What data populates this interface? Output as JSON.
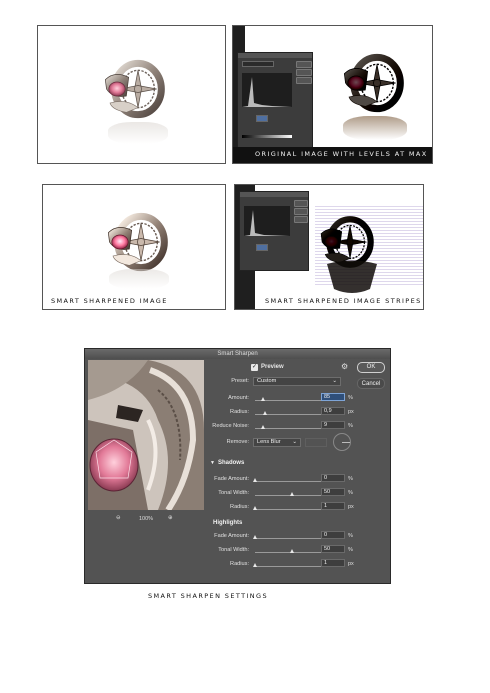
{
  "captions": {
    "original": "ORIGINAL IMAGE WITH LEVELS AT MAX",
    "smart_sharpened": "SMART SHARPENED IMAGE",
    "stripes": "SMART SHARPENED IMAGE STRIPES",
    "settings": "SMART SHARPEN SETTINGS"
  },
  "dialog": {
    "title": "Smart Sharpen",
    "preview_label": "Preview",
    "preview_checked": true,
    "ok_label": "OK",
    "cancel_label": "Cancel",
    "zoom": "100%",
    "preset_label": "Preset:",
    "preset_value": "Custom",
    "amount": {
      "label": "Amount:",
      "value": "85",
      "unit": "%"
    },
    "radius": {
      "label": "Radius:",
      "value": "0,9",
      "unit": "px"
    },
    "noise": {
      "label": "Reduce Noise:",
      "value": "9",
      "unit": "%"
    },
    "remove": {
      "label": "Remove:",
      "value": "Lens Blur"
    },
    "shadows": {
      "title": "Shadows",
      "fade": {
        "label": "Fade Amount:",
        "value": "0",
        "unit": "%"
      },
      "tonal": {
        "label": "Tonal Width:",
        "value": "50",
        "unit": "%"
      },
      "radius": {
        "label": "Radius:",
        "value": "1",
        "unit": "px"
      }
    },
    "highlights": {
      "title": "Highlights",
      "fade": {
        "label": "Fade Amount:",
        "value": "0",
        "unit": "%"
      },
      "tonal": {
        "label": "Tonal Width:",
        "value": "50",
        "unit": "%"
      },
      "radius": {
        "label": "Radius:",
        "value": "1",
        "unit": "px"
      }
    }
  }
}
